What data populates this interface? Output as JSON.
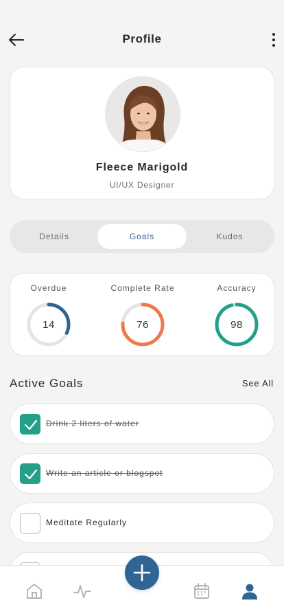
{
  "header": {
    "title": "Profile"
  },
  "profile": {
    "name": "Fleece Marigold",
    "role": "UI/UX Designer"
  },
  "tabs": [
    {
      "label": "Details",
      "active": false
    },
    {
      "label": "Goals",
      "active": true
    },
    {
      "label": "Kudos",
      "active": false
    }
  ],
  "stats": [
    {
      "label": "Overdue",
      "value": "14",
      "percent": 32,
      "color": "#2e6592"
    },
    {
      "label": "Complete Rate",
      "value": "76",
      "percent": 76,
      "color": "#f07a4f"
    },
    {
      "label": "Accuracy",
      "value": "98",
      "percent": 96,
      "color": "#23a088"
    }
  ],
  "goals_section": {
    "title": "Active Goals",
    "see_all": "See All"
  },
  "goals": [
    {
      "text": "Drink 2 liters of water",
      "done": true
    },
    {
      "text": "Write an article or blogspot",
      "done": true
    },
    {
      "text": "Meditate Regularly",
      "done": false
    },
    {
      "text": "",
      "done": false
    }
  ],
  "icons": {
    "back": "arrow-left-icon",
    "more": "more-vertical-icon",
    "home": "home-icon",
    "activity": "activity-icon",
    "add": "plus-icon",
    "calendar": "calendar-icon",
    "profile": "user-icon"
  },
  "colors": {
    "accent": "#2e6592",
    "success": "#23a088",
    "warning": "#f07a4f",
    "nav_inactive": "#b5b5b5"
  }
}
